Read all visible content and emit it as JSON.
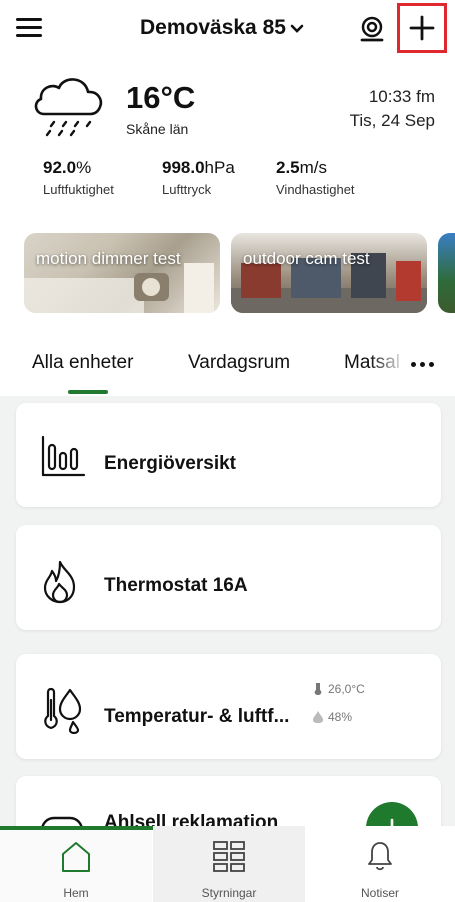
{
  "header": {
    "home_name": "Demoväska 85",
    "icons": {
      "menu": "menu-icon",
      "chevron": "chevron-down-icon",
      "camera": "camera-icon",
      "add": "plus-icon"
    },
    "highlight_color": "#e0262f"
  },
  "weather": {
    "icon": "cloud-rain-icon",
    "temperature": "16°C",
    "region": "Skåne län",
    "time": "10:33 fm",
    "date": "Tis, 24 Sep",
    "stats": [
      {
        "value": "92.0",
        "unit": "%",
        "label": "Luftfuktighet"
      },
      {
        "value": "998.0",
        "unit": "hPa",
        "label": "Lufttryck"
      },
      {
        "value": "2.5",
        "unit": "m/s",
        "label": "Vindhastighet"
      }
    ]
  },
  "scenes": [
    {
      "label": "motion dimmer test"
    },
    {
      "label": "outdoor cam test"
    },
    {
      "label": ""
    }
  ],
  "tabs": {
    "items": [
      {
        "label": "Alla enheter",
        "active": true
      },
      {
        "label": "Vardagsrum",
        "active": false
      },
      {
        "label": "Matsal",
        "active": false
      }
    ],
    "more_icon": "more-horizontal-icon"
  },
  "devices": [
    {
      "title": "Energiöversikt",
      "icon": "bar-chart-icon"
    },
    {
      "title": "Thermostat 16A",
      "icon": "flame-icon"
    },
    {
      "title": "Temperatur- & luftf...",
      "icon": "thermometer-humidity-icon",
      "temperature": "26,0°C",
      "humidity": "48%"
    },
    {
      "title": "Ahlsell reklamation",
      "icon": "device-icon"
    }
  ],
  "bottom_nav": [
    {
      "label": "Hem",
      "icon": "home-icon",
      "active": true
    },
    {
      "label": "Styrningar",
      "icon": "grid-icon",
      "active": false
    },
    {
      "label": "Notiser",
      "icon": "bell-icon",
      "active": false
    }
  ],
  "colors": {
    "accent": "#1f7a2e",
    "content_background": "#f1f2f2"
  }
}
